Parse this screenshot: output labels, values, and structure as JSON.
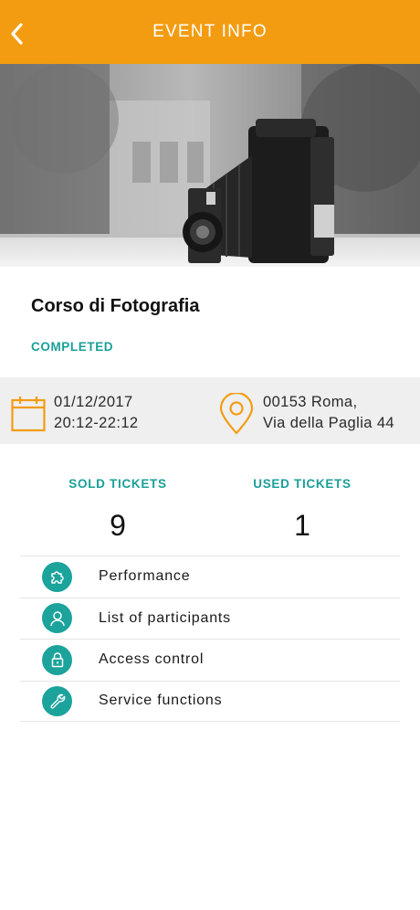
{
  "header": {
    "title": "EVENT INFO",
    "back_icon": "chevron-left-icon",
    "background": "#f39c12"
  },
  "hero": {
    "subject": "vintage folding camera photo (black and white)"
  },
  "event": {
    "title": "Corso di Fotografia",
    "status": "COMPLETED",
    "date": "01/12/2017",
    "time": "20:12-22:12",
    "address_line1": "00153 Roma,",
    "address_line2": "Via della Paglia 44"
  },
  "stats": {
    "sold_label": "SOLD TICKETS",
    "sold_value": "9",
    "used_label": "USED TICKETS",
    "used_value": "1"
  },
  "menu": {
    "items": [
      {
        "label": "Performance",
        "icon": "puzzle-icon"
      },
      {
        "label": "List of participants",
        "icon": "person-icon"
      },
      {
        "label": "Access control",
        "icon": "lock-icon"
      },
      {
        "label": "Service functions",
        "icon": "wrench-icon"
      }
    ]
  },
  "colors": {
    "accent": "#f39c12",
    "teal": "#1ba39c",
    "band": "#efefef"
  }
}
